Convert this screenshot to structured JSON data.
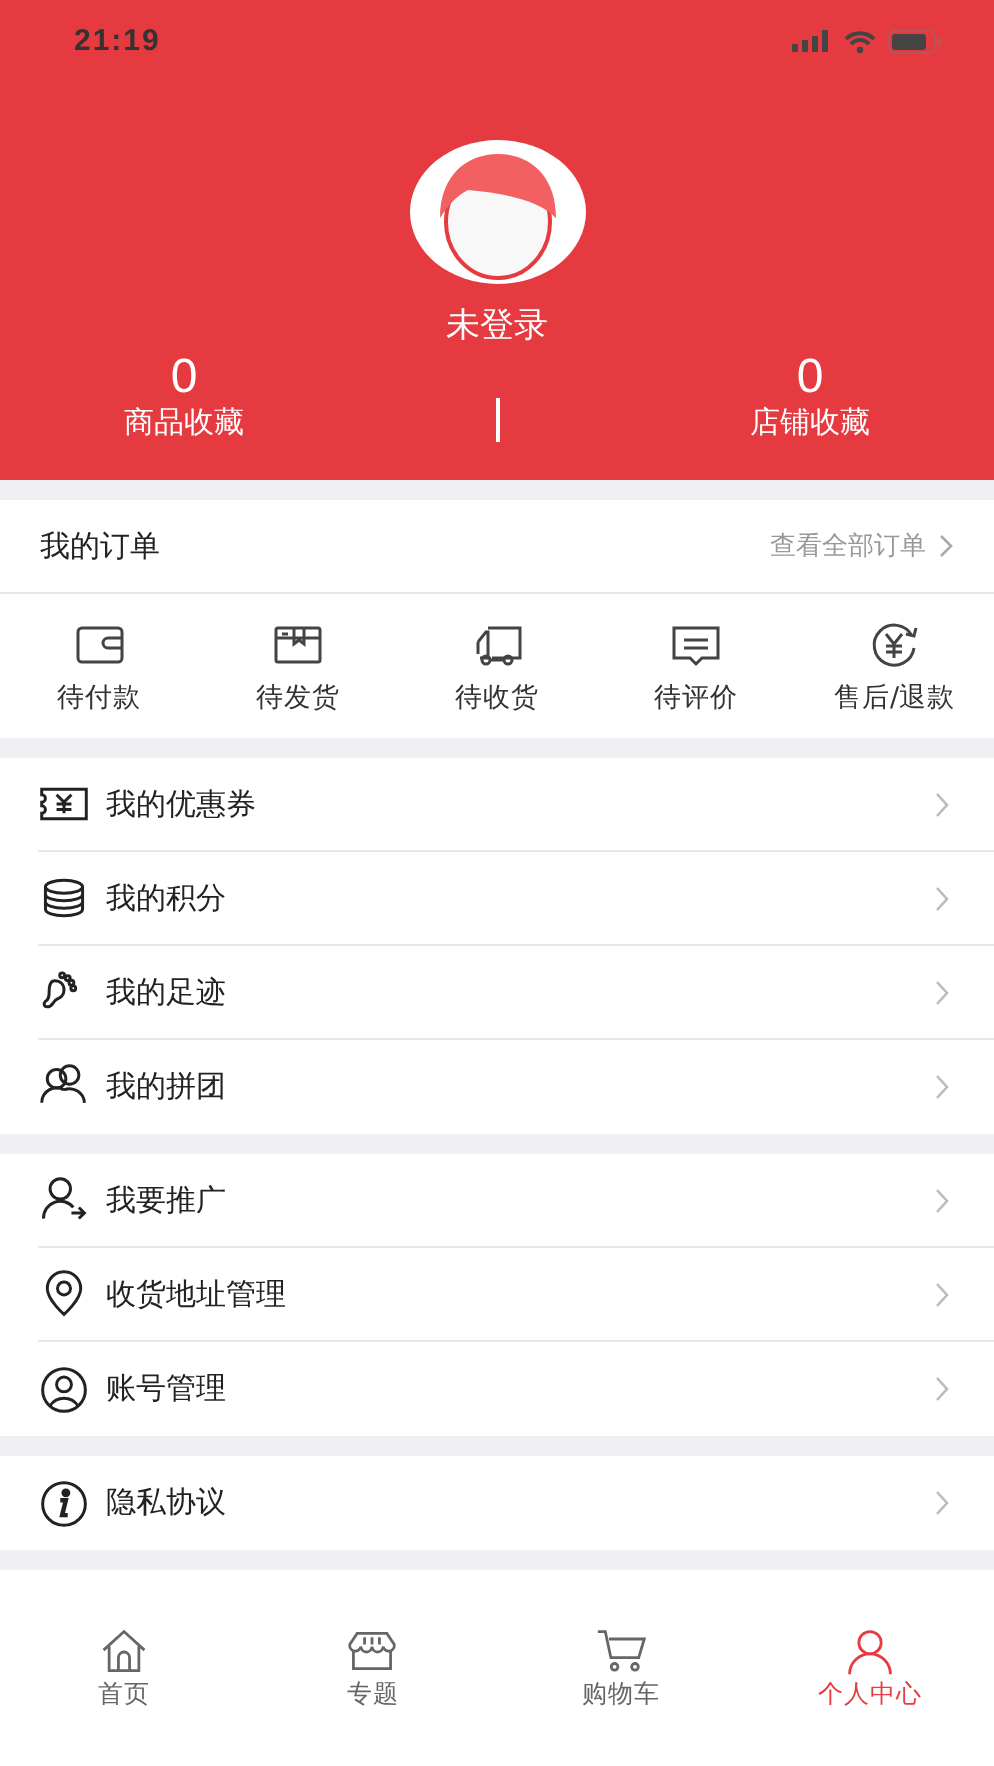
{
  "status_bar": {
    "time": "21:19"
  },
  "profile": {
    "username": "未登录"
  },
  "stats": [
    {
      "value": "0",
      "label": "商品收藏"
    },
    {
      "value": "0",
      "label": "店铺收藏"
    }
  ],
  "orders": {
    "title": "我的订单",
    "link": "查看全部订单",
    "items": [
      {
        "label": "待付款"
      },
      {
        "label": "待发货"
      },
      {
        "label": "待收货"
      },
      {
        "label": "待评价"
      },
      {
        "label": "售后/退款"
      }
    ]
  },
  "menu_groups": [
    [
      {
        "label": "我的优惠券"
      },
      {
        "label": "我的积分"
      },
      {
        "label": "我的足迹"
      },
      {
        "label": "我的拼团"
      }
    ],
    [
      {
        "label": "我要推广"
      },
      {
        "label": "收货地址管理"
      },
      {
        "label": "账号管理"
      }
    ],
    [
      {
        "label": "隐私协议"
      }
    ]
  ],
  "tab_bar": [
    {
      "label": "首页",
      "selected": false
    },
    {
      "label": "专题",
      "selected": false
    },
    {
      "label": "购物车",
      "selected": false
    },
    {
      "label": "个人中心",
      "selected": true
    }
  ]
}
